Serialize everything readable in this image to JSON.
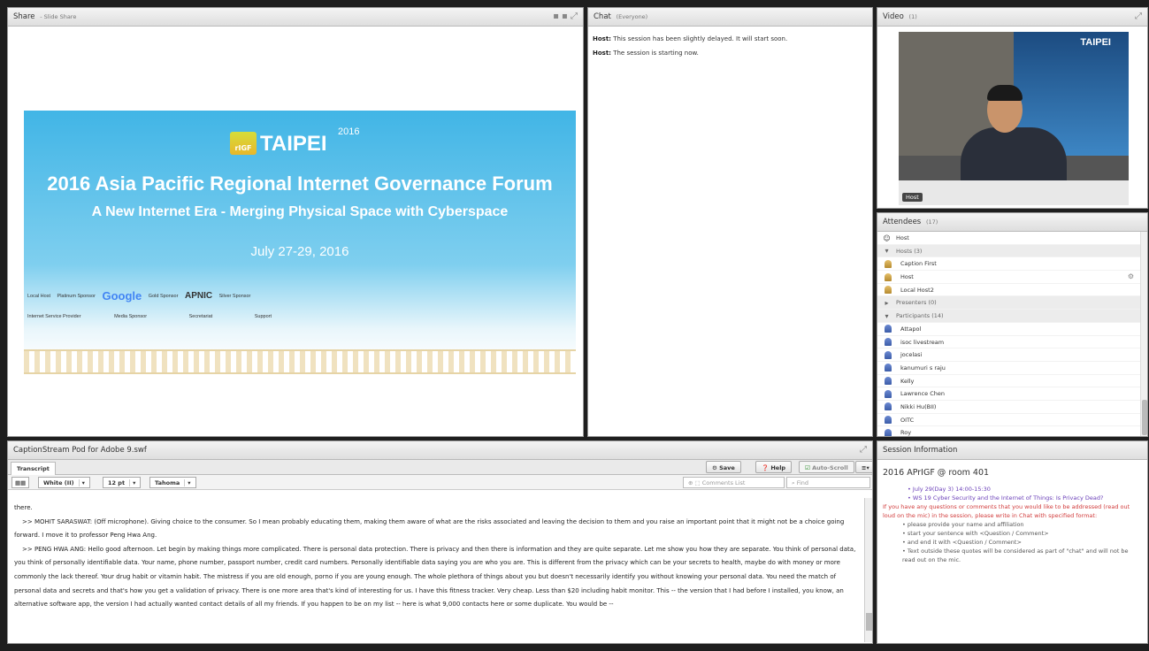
{
  "share": {
    "title": "Share",
    "subtitle": "- Slide Share",
    "slide": {
      "logo_small": "rIGF",
      "logo_city": "TAIPEI",
      "logo_year": "2016",
      "heading": "2016 Asia Pacific Regional Internet Governance Forum",
      "subheading": "A New Internet Era - Merging Physical Space with Cyberspace",
      "dates": "July 27-29, 2016",
      "row1": [
        "Local Host",
        "Platinum Sponsor",
        "Google",
        "Gold Sponsor",
        "APNIC",
        "Silver Sponsor"
      ],
      "row2": [
        "Internet Service Provider",
        "Media Sponsor",
        "Secretariat",
        "Support"
      ]
    }
  },
  "chat": {
    "title": "Chat",
    "subtitle": "(Everyone)",
    "messages": [
      {
        "sender": "Host:",
        "text": "This session has been slightly delayed. It will start soon."
      },
      {
        "sender": "Host:",
        "text": "The session is starting now."
      }
    ]
  },
  "video": {
    "title": "Video",
    "count": "(1)",
    "overlay_label": "Host",
    "screen_text": "TAIPEI"
  },
  "attendees": {
    "title": "Attendees",
    "count": "(17)",
    "me": "Host",
    "hosts_header": "Hosts (3)",
    "hosts": [
      "Caption First",
      "Host",
      "Local Host2"
    ],
    "presenters_header": "Presenters (0)",
    "participants_header": "Participants (14)",
    "participants": [
      "Attapol",
      "isoc livestream",
      "jocelasi",
      "kanumuri s raju",
      "Kelly",
      "Lawrence Chen",
      "Nikki Hu(BII)",
      "OITC",
      "Roy"
    ]
  },
  "caption": {
    "title": "CaptionStream Pod for Adobe 9.swf",
    "tab": "Transcript",
    "save": "Save",
    "help": "Help",
    "autoscroll": "Auto-Scroll",
    "color": "White (II)",
    "size": "12 pt",
    "font": "Tahoma",
    "comments_placeholder": "Comments List",
    "find_placeholder": "Find",
    "paragraphs": [
      "there.",
      ">> MOHIT SARASWAT: (Off microphone). Giving choice to the consumer. So I mean probably educating them, making them aware of what are the risks associated and leaving the decision to them and you raise an important point that it might not be a choice going forward. I move it to professor Peng Hwa Ang.",
      ">> PENG HWA ANG: Hello good afternoon. Let begin by making things more complicated. There is personal data protection. There is privacy and then there is information and they are quite separate. Let me show you how they are separate. You think of personal data, you think of personally identifiable data. Your name, phone number, passport number, credit card numbers. Personally identifiable data saying you are who you are. This is different from the privacy which can be your secrets to health, maybe do with money or more commonly the lack thereof. Your drug habit or vitamin habit. The mistress if you are old enough, porno if you are young enough. The whole plethora of things about you but doesn't necessarily identify you without knowing your personal data. You need the match of personal data and secrets and that's how you get a validation of privacy. There is one more area that's kind of interesting for us. I have this fitness tracker. Very cheap. Less than $20 including habit monitor. This -- the version that I had before I installed, you know, an alternative software app, the version I had actually wanted contact details of all my friends. If you happen to be on my list -- here is what 9,000 contacts here or some duplicate. You would be --"
    ]
  },
  "session": {
    "title": "Session Information",
    "room": "2016 APrIGF @ room 401",
    "schedule": "July 29(Day 3) 14:00-15:30",
    "workshop": "WS 19 Cyber Security and the Internet of Things: Is Privacy Dead?",
    "notice": "If you have any questions or comments that you would like to be addressed (read out loud on the mic) in the session, please write in Chat with specified format:",
    "bullets": [
      "please provide your name and affiliation",
      "start your sentence with <Question / Comment>",
      "and end it with <Question / Comment>",
      "Text outside these quotes will be considered as part of \"chat\" and will not be read out on the mic."
    ]
  }
}
